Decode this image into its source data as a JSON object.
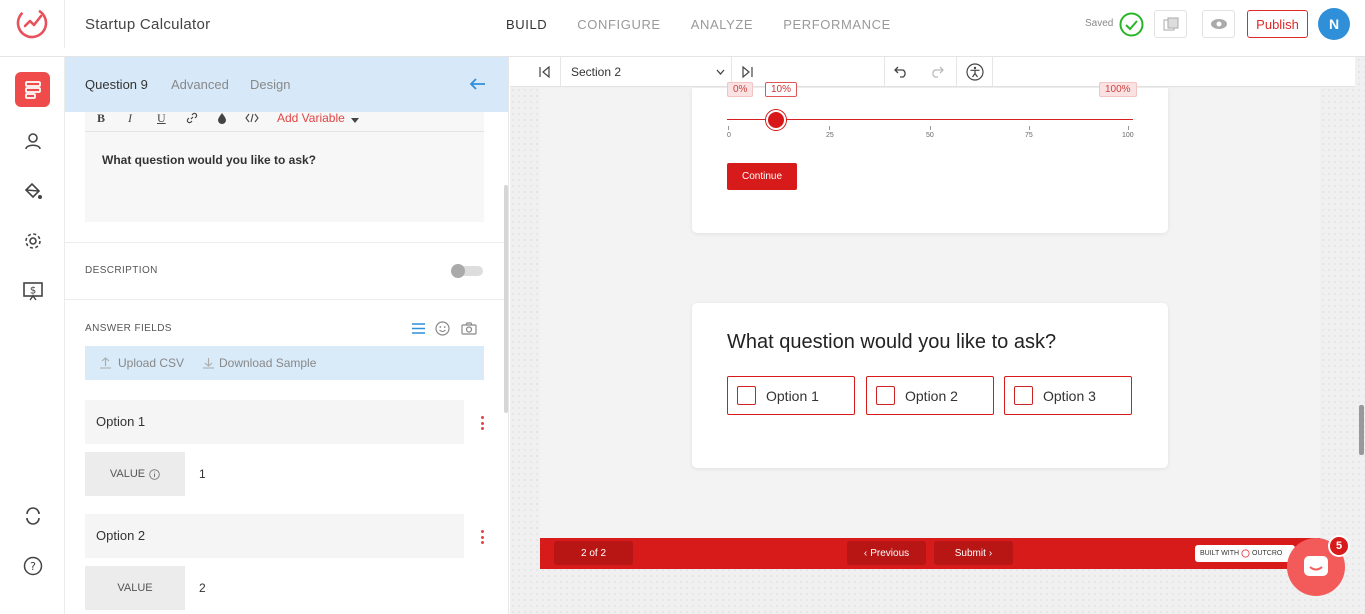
{
  "app": {
    "title": "Startup Calculator"
  },
  "nav": {
    "build": "BUILD",
    "configure": "CONFIGURE",
    "analyze": "ANALYZE",
    "performance": "PERFORMANCE"
  },
  "header": {
    "saved": "Saved",
    "publish": "Publish",
    "avatar_initial": "N"
  },
  "panel": {
    "tabs": {
      "question": "Question 9",
      "advanced": "Advanced",
      "design": "Design"
    },
    "format": {
      "bold": "B",
      "italic": "I",
      "underline": "U",
      "add_variable": "Add Variable"
    },
    "question_text": "What question would you like to ask?",
    "description_label": "DESCRIPTION",
    "answer_fields_label": "ANSWER FIELDS",
    "upload_csv": "Upload CSV",
    "download_sample": "Download Sample",
    "options": [
      {
        "label": "Option 1",
        "value_label": "VALUE",
        "value": "1"
      },
      {
        "label": "Option 2",
        "value_label": "VALUE",
        "value": "2"
      }
    ]
  },
  "toolbar": {
    "section": "Section 2"
  },
  "preview": {
    "slider": {
      "min_tag": "0%",
      "current_tag": "10%",
      "max_tag": "100%",
      "ticks": [
        "0",
        "25",
        "50",
        "75",
        "100"
      ],
      "value_fraction": 0.1
    },
    "continue": "Continue",
    "question": "What question would you like to ask?",
    "choices": [
      "Option 1",
      "Option 2",
      "Option 3"
    ],
    "footer": {
      "page": "2 of 2",
      "previous": "Previous",
      "submit": "Submit",
      "built_with": "BUILT WITH",
      "built_brand": "OUTCRO"
    }
  },
  "chat": {
    "badge": "5"
  },
  "colors": {
    "accent": "#d71a1a",
    "blue_header": "#d7e9f8",
    "avatar": "#2f8fd8"
  }
}
